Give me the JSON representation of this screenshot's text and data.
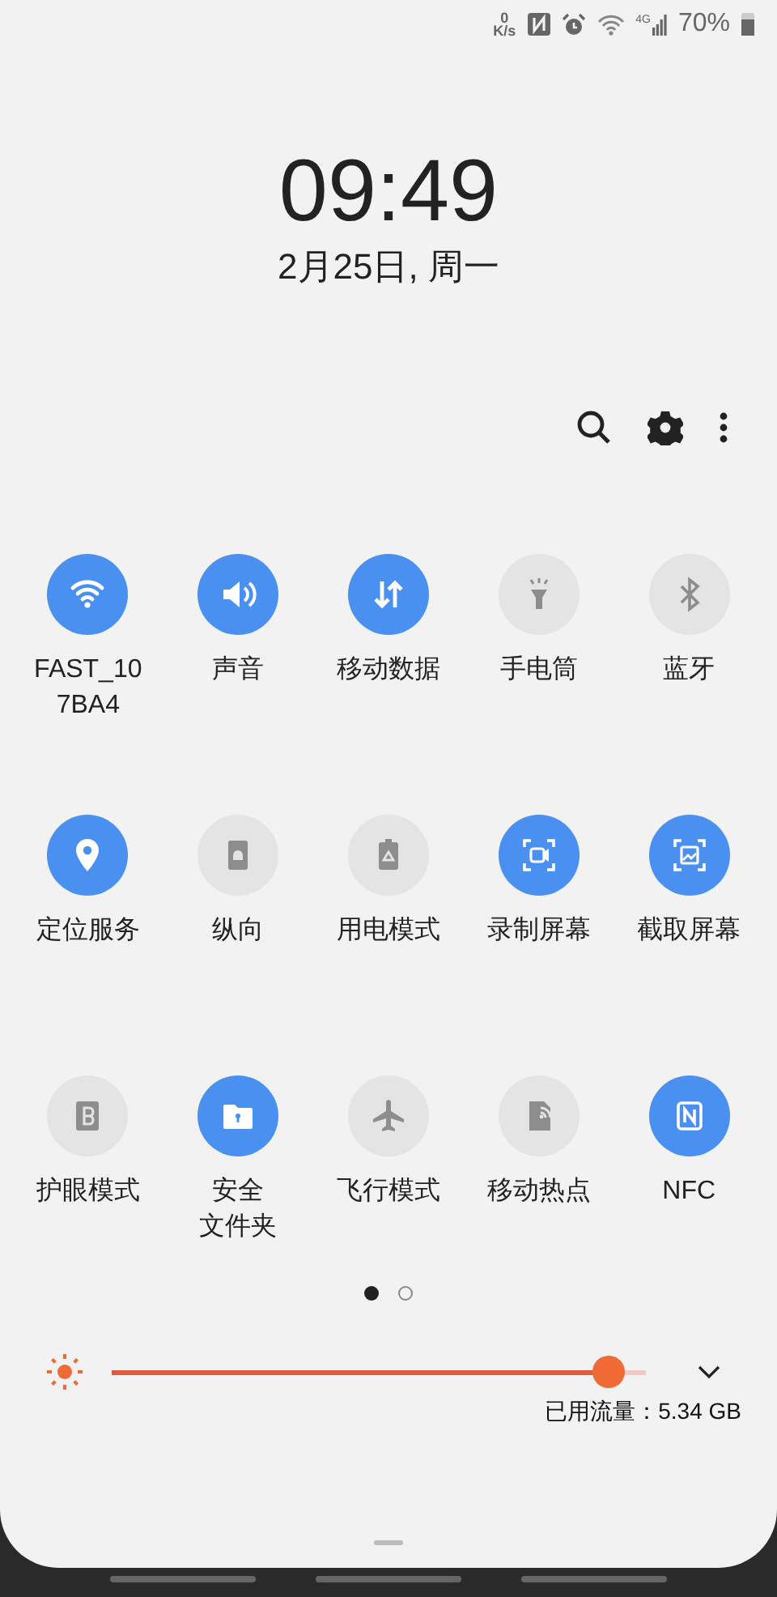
{
  "status_bar": {
    "speed_value": "0",
    "speed_unit": "K/s",
    "network_type": "4G",
    "battery": "70%"
  },
  "clock": {
    "time": "09:49",
    "date": "2月25日, 周一"
  },
  "tiles": [
    {
      "label": [
        "FAST_10",
        "7BA4"
      ],
      "on": true
    },
    {
      "label": "声音",
      "on": true
    },
    {
      "label": "移动数据",
      "on": true
    },
    {
      "label": "手电筒",
      "on": false
    },
    {
      "label": "蓝牙",
      "on": false
    },
    {
      "label": "定位服务",
      "on": true
    },
    {
      "label": "纵向",
      "on": false
    },
    {
      "label": "用电模式",
      "on": false
    },
    {
      "label": "录制屏幕",
      "on": true
    },
    {
      "label": "截取屏幕",
      "on": true
    },
    {
      "label": "护眼模式",
      "on": false
    },
    {
      "label": [
        "安全",
        "文件夹"
      ],
      "on": true
    },
    {
      "label": "飞行模式",
      "on": false
    },
    {
      "label": "移动热点",
      "on": false
    },
    {
      "label": "NFC",
      "on": true
    }
  ],
  "pages": [
    {
      "selected": true
    },
    {
      "selected": false
    }
  ],
  "brightness": {
    "level": 0.93
  },
  "data_usage": "已用流量：5.34 GB"
}
